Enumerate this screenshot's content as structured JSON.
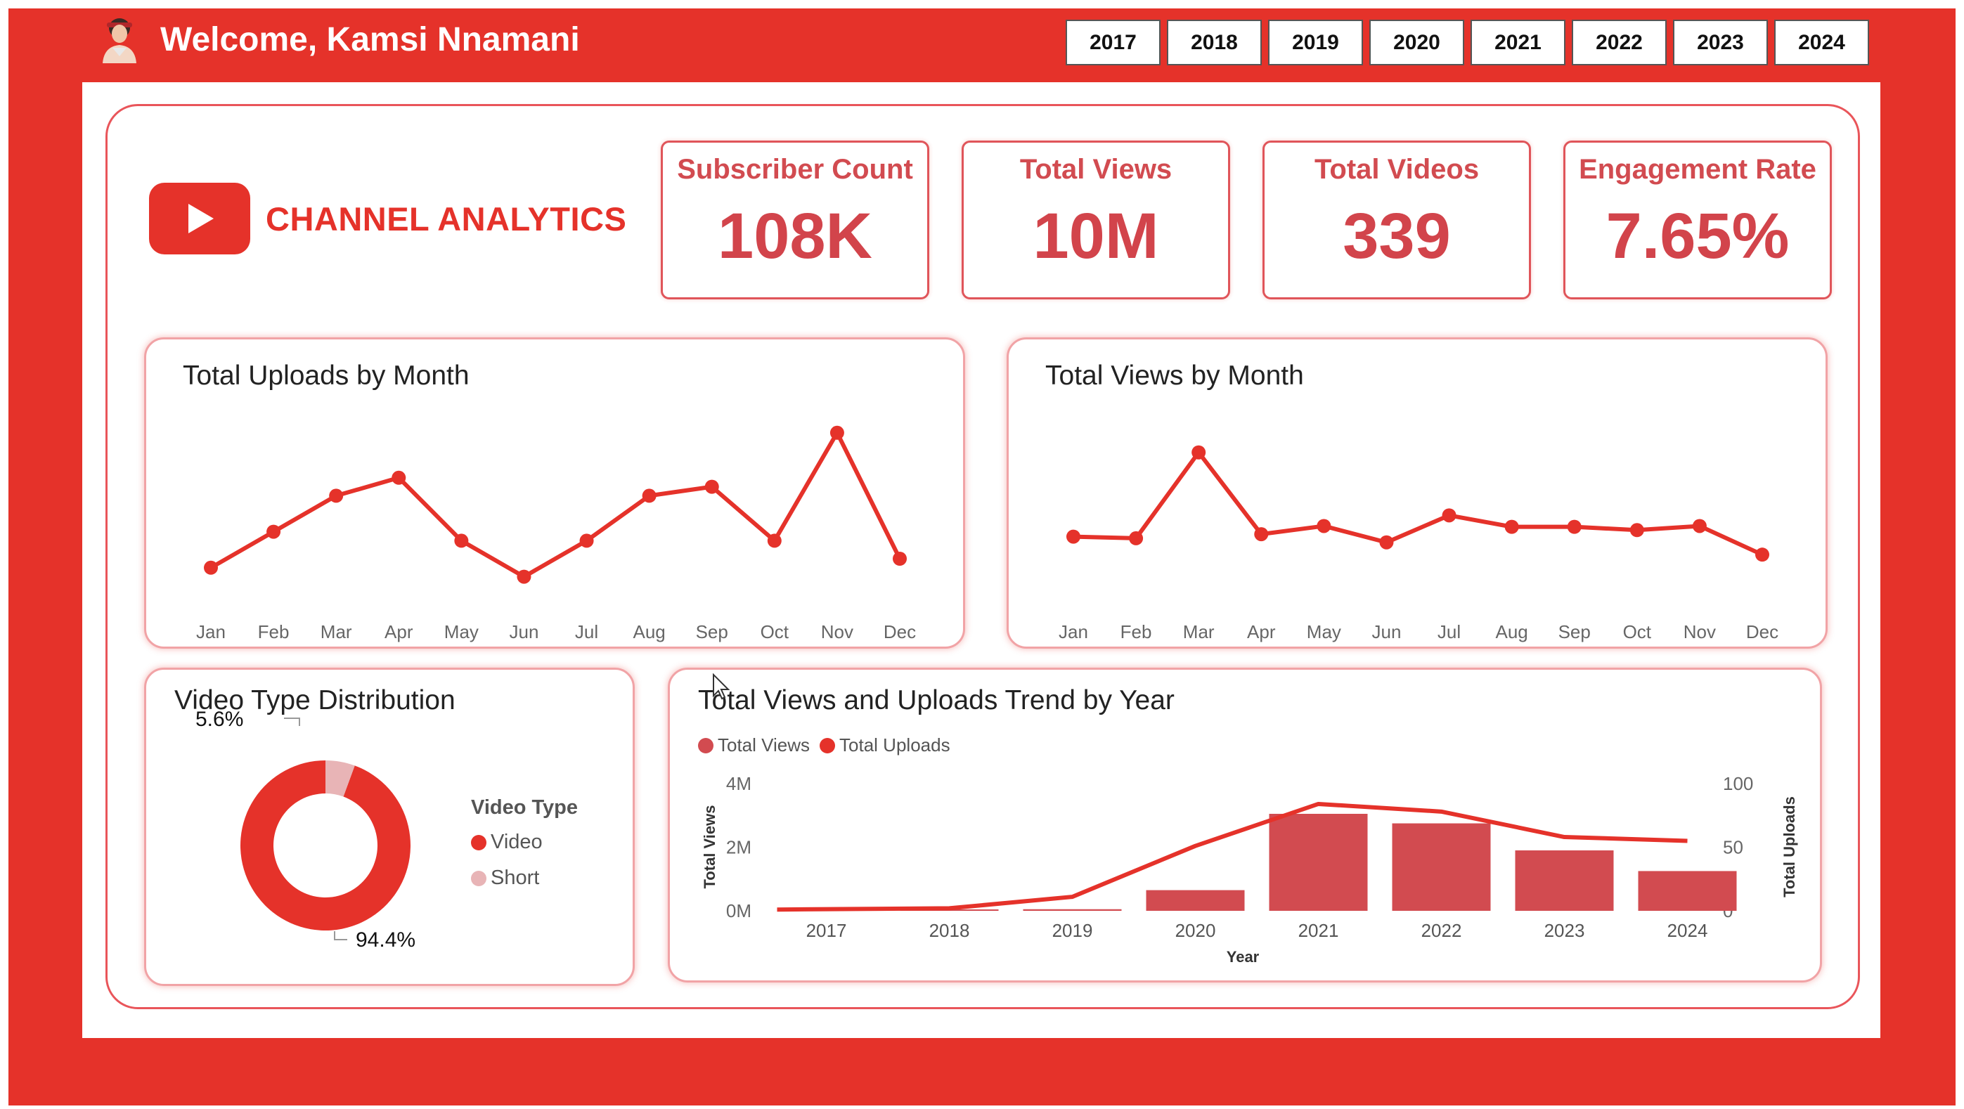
{
  "header": {
    "welcome": "Welcome, Kamsi Nnamani",
    "years": [
      "2017",
      "2018",
      "2019",
      "2020",
      "2021",
      "2022",
      "2023",
      "2024"
    ]
  },
  "brand": {
    "title": "CHANNEL ANALYTICS",
    "icon": "youtube-play-icon"
  },
  "kpis": [
    {
      "label": "Subscriber Count",
      "value": "108K"
    },
    {
      "label": "Total Views",
      "value": "10M"
    },
    {
      "label": "Total Videos",
      "value": "339"
    },
    {
      "label": "Engagement Rate",
      "value": "7.65%"
    }
  ],
  "colors": {
    "accent": "#e5322a",
    "bar": "#d24b50",
    "short": "#e8b4b6",
    "text": "#222222"
  },
  "chart_data": [
    {
      "type": "line",
      "title": "Total Uploads by Month",
      "categories": [
        "Jan",
        "Feb",
        "Mar",
        "Apr",
        "May",
        "Jun",
        "Jul",
        "Aug",
        "Sep",
        "Oct",
        "Nov",
        "Dec"
      ],
      "values": [
        12,
        24,
        36,
        42,
        21,
        9,
        21,
        36,
        39,
        21,
        57,
        15
      ],
      "ylim": [
        0,
        60
      ]
    },
    {
      "type": "line",
      "title": "Total Views by Month",
      "categories": [
        "Jan",
        "Feb",
        "Mar",
        "Apr",
        "May",
        "Jun",
        "Jul",
        "Aug",
        "Sep",
        "Oct",
        "Nov",
        "Dec"
      ],
      "values": [
        0.82,
        0.8,
        1.85,
        0.85,
        0.95,
        0.75,
        1.08,
        0.94,
        0.94,
        0.9,
        0.95,
        0.6
      ],
      "ylim": [
        0,
        2.2
      ]
    },
    {
      "type": "pie",
      "title": "Video Type Distribution",
      "legend_title": "Video Type",
      "slices": [
        {
          "name": "Video",
          "value": 94.4,
          "label": "94.4%"
        },
        {
          "name": "Short",
          "value": 5.6,
          "label": "5.6%"
        }
      ]
    },
    {
      "type": "bar",
      "title": "Total Views and Uploads Trend by Year",
      "categories": [
        "2017",
        "2018",
        "2019",
        "2020",
        "2021",
        "2022",
        "2023",
        "2024"
      ],
      "xlabel": "Year",
      "ylabel": "Total Views",
      "y2label": "Total Uploads",
      "yticks": [
        "0M",
        "2M",
        "4M"
      ],
      "y2ticks": [
        "0",
        "50",
        "100"
      ],
      "ylim": [
        0,
        4
      ],
      "y2lim": [
        0,
        100
      ],
      "series": [
        {
          "name": "Total Views",
          "type": "bar",
          "values": [
            0.01,
            0.02,
            0.05,
            0.65,
            3.05,
            2.75,
            1.9,
            1.25
          ]
        },
        {
          "name": "Total Uploads",
          "type": "line",
          "values": [
            1,
            2,
            11,
            51,
            84,
            78,
            58,
            55
          ]
        }
      ]
    }
  ]
}
